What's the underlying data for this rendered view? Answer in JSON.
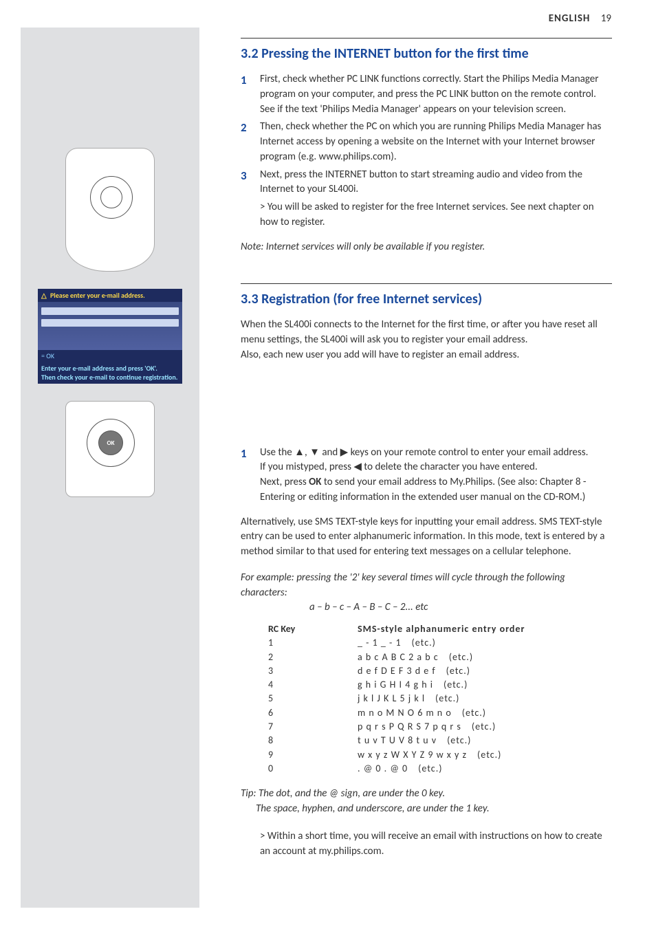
{
  "header": {
    "lang": "ENGLISH",
    "page": "19"
  },
  "sidebar": {
    "email_title": "Please enter your e-mail address.",
    "email_ok": "= OK",
    "email_hint1": "Enter your e-mail address and press 'OK'.",
    "email_hint2": "Then check your e-mail to continue registration.",
    "nav_ok": "OK"
  },
  "s32": {
    "heading": "3.2 Pressing the INTERNET button for the first time",
    "i1": "First, check whether PC LINK functions correctly. Start the Philips Media Manager program on your computer, and press the PC LINK button on the remote control.",
    "i1b": "See if the text 'Philips Media Manager' appears on your television screen.",
    "i2": "Then, check whether the PC on which you are running Philips Media Manager has Internet access by opening a website on the Internet with your Internet browser program (e.g. www.philips.com).",
    "i3": "Next, press the INTERNET button to start streaming audio and video from the Internet to your SL400i.",
    "i3_sub": "> You will be asked to register for the free Internet services. See next chapter on how to register.",
    "note": "Note: Internet services will only be available if you register."
  },
  "s33": {
    "heading": "3.3 Registration (for free Internet services)",
    "intro1": "When the SL400i connects to the Internet for the first time, or after you have reset all menu settings, the SL400i will ask you to register your email address.",
    "intro2": "Also, each new user you add will have to register an email address.",
    "step1a": "Use the ▲, ▼ and ▶ keys on your remote control to enter your email address.",
    "step1b": "If you mistyped, press ◀ to delete the character you have entered.",
    "step1c_a": "Next, press ",
    "step1c_ok": "OK",
    "step1c_b": " to send your email address to My.Philips. (See also: Chapter 8 - Entering or editing information in the extended user manual on the CD-ROM.)",
    "alt": "Alternatively, use SMS TEXT-style keys for inputting your email address. SMS TEXT-style entry can be used to enter alphanumeric information. In this mode, text is entered by a method similar to that used for entering text messages on a cellular telephone.",
    "example": "For example: pressing the '2' key several times will cycle through the following characters:",
    "example_cycle": "a – b – c – A – B – C – 2... etc",
    "table": {
      "h1": "RC Key",
      "h2": "SMS-style alphanumeric entry order",
      "rows": [
        {
          "k": "1",
          "v": "_ - 1 _ - 1 (etc.)"
        },
        {
          "k": "2",
          "v": "a b c A B C 2 a b c (etc.)"
        },
        {
          "k": "3",
          "v": "d e f D E F 3 d e f (etc.)"
        },
        {
          "k": "4",
          "v": "g h i G H I 4 g h i (etc.)"
        },
        {
          "k": "5",
          "v": "j k l J K L 5 j k l (etc.)"
        },
        {
          "k": "6",
          "v": "m n o M N O 6 m n o (etc.)"
        },
        {
          "k": "7",
          "v": "p q r s P Q R S 7 p q r s (etc.)"
        },
        {
          "k": "8",
          "v": "t u v T U V 8 t u v (etc.)"
        },
        {
          "k": "9",
          "v": "w x y z W X Y Z 9 w x y z (etc.)"
        },
        {
          "k": "0",
          "v": ". @ 0 . @ 0 (etc.)"
        }
      ]
    },
    "tip1": "Tip: The dot, and the @ sign, are under the 0 key.",
    "tip2": "The space, hyphen, and underscore, are under the 1 key.",
    "closing": "> Within a short time, you will receive an email with instructions on how to create an account at my.philips.com."
  }
}
